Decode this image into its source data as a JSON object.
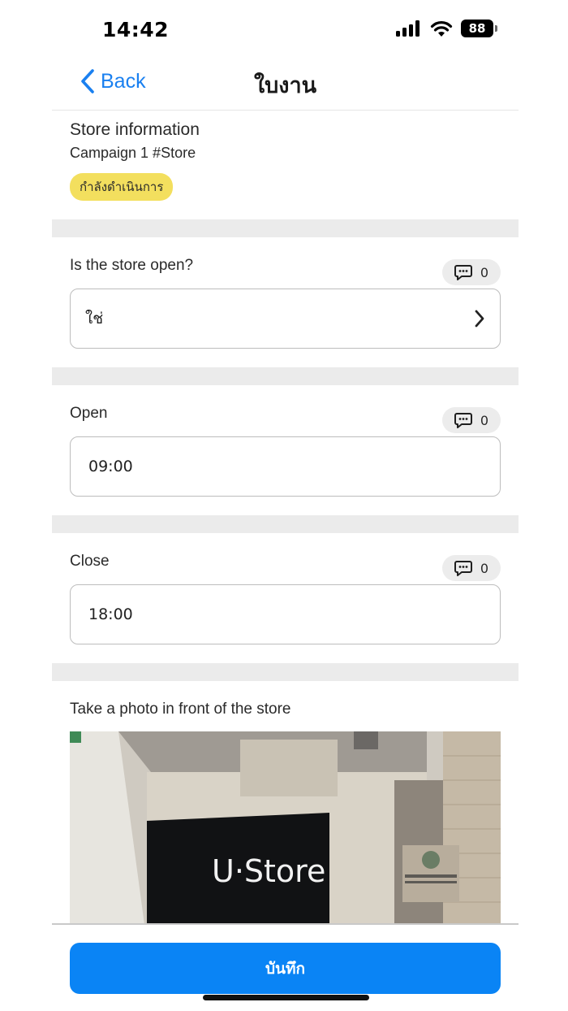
{
  "status_bar": {
    "time": "14:42",
    "battery": "88"
  },
  "nav": {
    "back_label": "Back",
    "title": "ใบงาน"
  },
  "info": {
    "title": "Store information",
    "subtitle": "Campaign 1 #Store",
    "status": "กำลังดำเนินการ"
  },
  "questions": [
    {
      "label": "Is the store open?",
      "comments": "0",
      "value": "ใช่"
    },
    {
      "label": "Open",
      "comments": "0",
      "value": "09:00"
    },
    {
      "label": "Close",
      "comments": "0",
      "value": "18:00"
    }
  ],
  "photo": {
    "label": "Take a photo in front of the store",
    "sign_text": "U·Store"
  },
  "footer": {
    "save_label": "บันทึก"
  },
  "colors": {
    "accent": "#0a84f5",
    "badge": "#f3df5e",
    "back": "#1a80f0"
  }
}
